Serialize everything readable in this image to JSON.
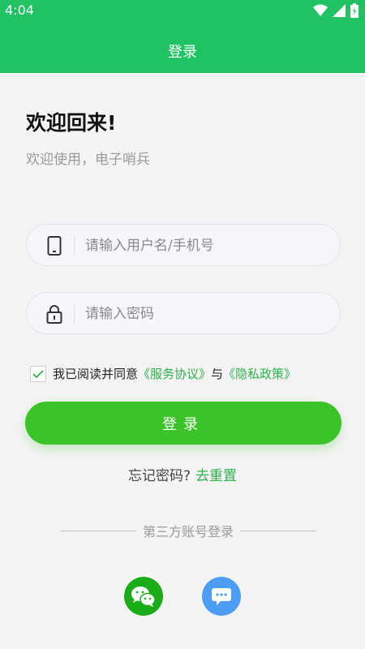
{
  "status_bar": {
    "time": "4:04"
  },
  "app_bar": {
    "title": "登录"
  },
  "welcome": {
    "title": "欢迎回来!",
    "subtitle": "欢迎使用，电子哨兵"
  },
  "form": {
    "username_placeholder": "请输入用户名/手机号",
    "username_icon": "phone-icon",
    "password_placeholder": "请输入密码",
    "password_icon": "lock-icon"
  },
  "agreement": {
    "checked": true,
    "prefix": "我已阅读并同意",
    "service_link": "《服务协议》",
    "conjunction": "与",
    "privacy_link": "《隐私政策》"
  },
  "login_button": {
    "label": "登录"
  },
  "forgot": {
    "text": "忘记密码?",
    "link": "去重置"
  },
  "third_party": {
    "title": "第三方账号登录",
    "options": [
      {
        "icon": "wechat-icon",
        "color": "#1aad19"
      },
      {
        "icon": "sms-icon",
        "color": "#4e9df5"
      }
    ]
  },
  "colors": {
    "primary": "#20c263",
    "button": "#3cc32a",
    "link": "#2fb04a"
  }
}
